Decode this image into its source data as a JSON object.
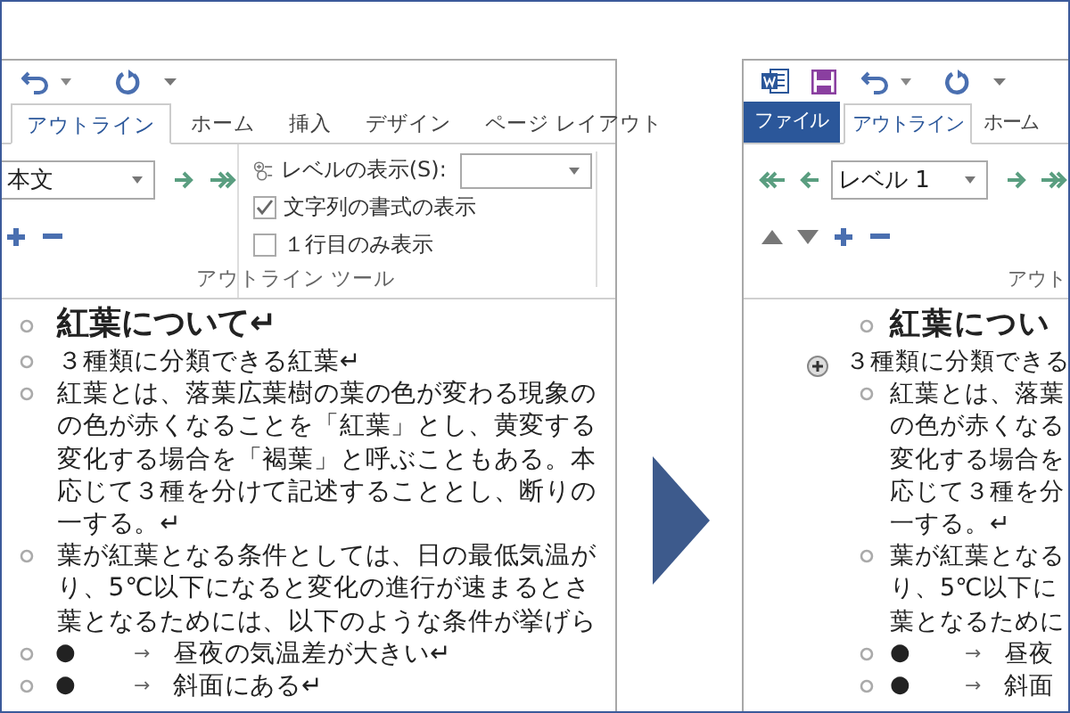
{
  "left_window": {
    "tabs": [
      {
        "label": "アウトライン",
        "selected": true
      },
      {
        "label": "ホーム",
        "selected": false
      },
      {
        "label": "挿入",
        "selected": false
      },
      {
        "label": "デザイン",
        "selected": false
      },
      {
        "label": "ページ レイアウト",
        "selected": false
      }
    ],
    "outline_level": {
      "value": "本文"
    },
    "show_level": {
      "label": "レベルの表示(S):"
    },
    "options": [
      {
        "label": "文字列の書式の表示",
        "checked": true
      },
      {
        "label": "１行目のみ表示",
        "checked": false
      }
    ],
    "group_label": "アウトライン ツール",
    "document": [
      {
        "kind": "heading",
        "lines": [
          "紅葉について↵"
        ]
      },
      {
        "kind": "body",
        "lines": [
          "３種類に分類できる紅葉↵"
        ]
      },
      {
        "kind": "body",
        "lines": [
          "紅葉とは、落葉広葉樹の葉の色が変わる現象の",
          "の色が赤くなることを「紅葉」とし、黄変する",
          "変化する場合を「褐葉」と呼ぶこともある。本",
          "応じて３種を分けて記述することとし、断りの",
          "一する。↵"
        ]
      },
      {
        "kind": "body",
        "lines": [
          "葉が紅葉となる条件としては、日の最低気温が",
          "り、5℃以下になると変化の進行が速まるとさ",
          "葉となるためには、以下のような条件が挙げら"
        ]
      },
      {
        "kind": "bullet",
        "bullet": "●",
        "arrow": "→",
        "text": "昼夜の気温差が大きい↵"
      },
      {
        "kind": "bullet",
        "bullet": "●",
        "arrow": "→",
        "text": "斜面にある↵"
      }
    ]
  },
  "right_window": {
    "tabs": [
      {
        "label": "ファイル",
        "kind": "file",
        "selected": false
      },
      {
        "label": "アウトライン",
        "kind": "tab",
        "selected": true
      },
      {
        "label": "ホーム",
        "kind": "tab",
        "selected": false
      }
    ],
    "outline_level": {
      "value": "レベル 1"
    },
    "group_label": "アウト",
    "document": [
      {
        "kind": "heading",
        "lines": [
          "紅葉につい"
        ]
      },
      {
        "kind": "expandable",
        "lines": [
          "３種類に分類できる"
        ],
        "children": [
          {
            "kind": "body",
            "lines": [
              "紅葉とは、落葉",
              "の色が赤くなる",
              "変化する場合を",
              "応じて３種を分",
              "一する。↵"
            ]
          },
          {
            "kind": "body",
            "lines": [
              "葉が紅葉となる",
              "り、5℃以下に",
              "葉となるために"
            ]
          },
          {
            "kind": "bullet",
            "bullet": "●",
            "arrow": "→",
            "text": "昼夜"
          },
          {
            "kind": "bullet",
            "bullet": "●",
            "arrow": "→",
            "text": "斜面"
          }
        ]
      }
    ]
  }
}
